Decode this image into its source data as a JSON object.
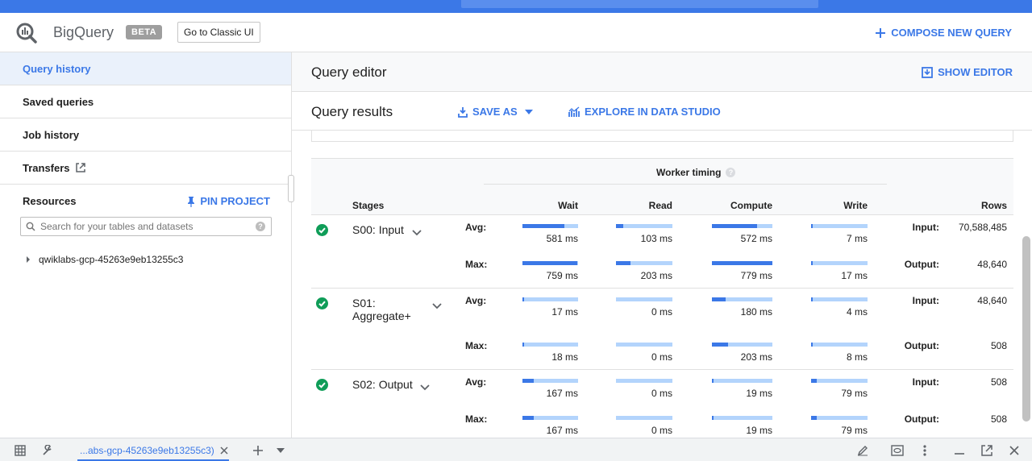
{
  "app": {
    "name": "BigQuery",
    "badge": "BETA",
    "classic_button": "Go to Classic UI",
    "compose_label": "COMPOSE NEW QUERY"
  },
  "sidebar": {
    "items": [
      {
        "label": "Query history",
        "active": true
      },
      {
        "label": "Saved queries"
      },
      {
        "label": "Job history"
      },
      {
        "label": "Transfers"
      }
    ],
    "resources_label": "Resources",
    "pin_label": "PIN PROJECT",
    "search_placeholder": "Search for your tables and datasets",
    "project": "qwiklabs-gcp-45263e9eb13255c3"
  },
  "editor": {
    "title": "Query editor",
    "show_editor": "SHOW EDITOR"
  },
  "results": {
    "title": "Query results",
    "save_as": "SAVE AS",
    "explore": "EXPLORE IN DATA STUDIO"
  },
  "timing": {
    "group_label": "Worker timing",
    "columns": {
      "stages": "Stages",
      "wait": "Wait",
      "read": "Read",
      "compute": "Compute",
      "write": "Write",
      "rows": "Rows"
    },
    "stages": [
      {
        "name": "S00: Input",
        "avg": {
          "label": "Avg:",
          "wait": "581 ms",
          "read": "103 ms",
          "compute": "572 ms",
          "write": "7 ms",
          "rows_label": "Input:",
          "rows": "70,588,485"
        },
        "max": {
          "label": "Max:",
          "wait": "759 ms",
          "read": "203 ms",
          "compute": "779 ms",
          "write": "17 ms",
          "rows_label": "Output:",
          "rows": "48,640"
        },
        "fills": {
          "avg": [
            0.75,
            0.13,
            0.74,
            0.02
          ],
          "max": [
            0.98,
            0.26,
            1.0,
            0.02
          ]
        }
      },
      {
        "name": "S01: Aggregate+",
        "avg": {
          "label": "Avg:",
          "wait": "17 ms",
          "read": "0 ms",
          "compute": "180 ms",
          "write": "4 ms",
          "rows_label": "Input:",
          "rows": "48,640"
        },
        "max": {
          "label": "Max:",
          "wait": "18 ms",
          "read": "0 ms",
          "compute": "203 ms",
          "write": "8 ms",
          "rows_label": "Output:",
          "rows": "508"
        },
        "fills": {
          "avg": [
            0.02,
            0.0,
            0.23,
            0.01
          ],
          "max": [
            0.02,
            0.0,
            0.26,
            0.01
          ]
        }
      },
      {
        "name": "S02: Output",
        "avg": {
          "label": "Avg:",
          "wait": "167 ms",
          "read": "0 ms",
          "compute": "19 ms",
          "write": "79 ms",
          "rows_label": "Input:",
          "rows": "508"
        },
        "max": {
          "label": "Max:",
          "wait": "167 ms",
          "read": "0 ms",
          "compute": "19 ms",
          "write": "79 ms",
          "rows_label": "Output:",
          "rows": "508"
        },
        "fills": {
          "avg": [
            0.21,
            0.0,
            0.02,
            0.1
          ],
          "max": [
            0.21,
            0.0,
            0.02,
            0.1
          ]
        }
      }
    ]
  },
  "bottom_bar": {
    "tab_label": "...abs-gcp-45263e9eb13255c3)"
  },
  "colors": {
    "accent": "#3b78e7",
    "bar_bg": "#b3d4fc",
    "success": "#0f9d58"
  }
}
